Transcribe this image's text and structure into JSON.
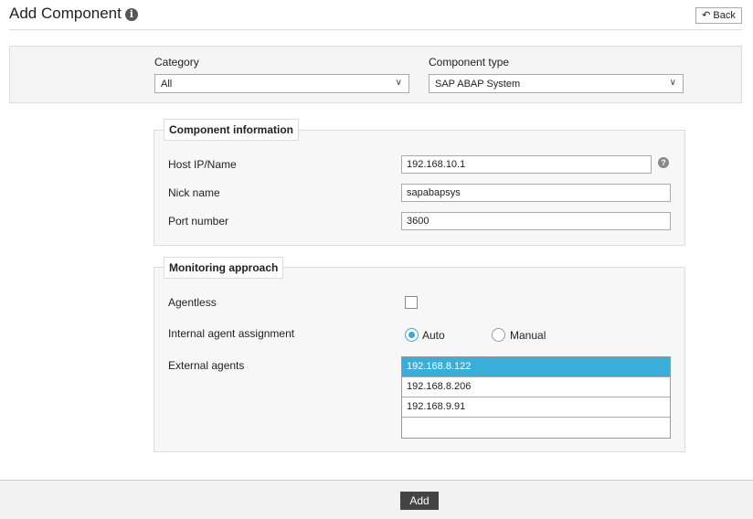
{
  "header": {
    "title": "Add Component",
    "back_label": "Back"
  },
  "filter": {
    "category_label": "Category",
    "category_value": "All",
    "type_label": "Component type",
    "type_value": "SAP ABAP System"
  },
  "component_info": {
    "legend": "Component information",
    "host_label": "Host IP/Name",
    "host_value": "192.168.10.1",
    "nick_label": "Nick name",
    "nick_value": "sapabapsys",
    "port_label": "Port number",
    "port_value": "3600"
  },
  "monitoring": {
    "legend": "Monitoring approach",
    "agentless_label": "Agentless",
    "agentless_checked": false,
    "internal_label": "Internal agent assignment",
    "auto_label": "Auto",
    "manual_label": "Manual",
    "selected": "Auto",
    "external_label": "External agents",
    "agents": [
      "192.168.8.122",
      "192.168.8.206",
      "192.168.9.91"
    ],
    "selected_agent": "192.168.8.122"
  },
  "footer": {
    "add_label": "Add"
  },
  "colors": {
    "accent": "#3aaed9",
    "button_dark": "#444444"
  }
}
